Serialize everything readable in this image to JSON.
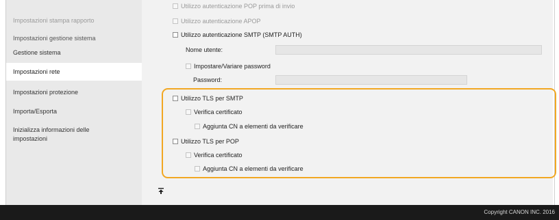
{
  "sidebar": {
    "items": [
      {
        "label": "Impostazioni stampa rapporto"
      },
      {
        "label": "Impostazioni gestione sistema"
      },
      {
        "label": "Gestione sistema"
      },
      {
        "label": "Impostazioni rete"
      },
      {
        "label": "Impostazioni protezione"
      },
      {
        "label": "Importa/Esporta"
      },
      {
        "label": "Inizializza informazioni delle impostazioni"
      }
    ]
  },
  "form": {
    "pop_auth_label": "Utilizzo autenticazione POP prima di invio",
    "apop_label": "Utilizzo autenticazione APOP",
    "smtp_auth_label": "Utilizzo autenticazione SMTP (SMTP AUTH)",
    "username_label": "Nome utente:",
    "set_password_label": "Impostare/Variare password",
    "password_label": "Password:",
    "tls_smtp_label": "Utilizzo TLS per SMTP",
    "verify_cert_smtp_label": "Verifica certificato",
    "add_cn_smtp_label": "Aggiunta CN a elementi da verificare",
    "tls_pop_label": "Utilizzo TLS per POP",
    "verify_cert_pop_label": "Verifica certificato",
    "add_cn_pop_label": "Aggiunta CN a elementi da verificare"
  },
  "footer": {
    "copyright": "Copyright CANON INC. 2016"
  },
  "colors": {
    "highlight": "#f2a722",
    "footer_bg": "#1a1a1a",
    "sidebar_bg": "#e9e9e9"
  }
}
